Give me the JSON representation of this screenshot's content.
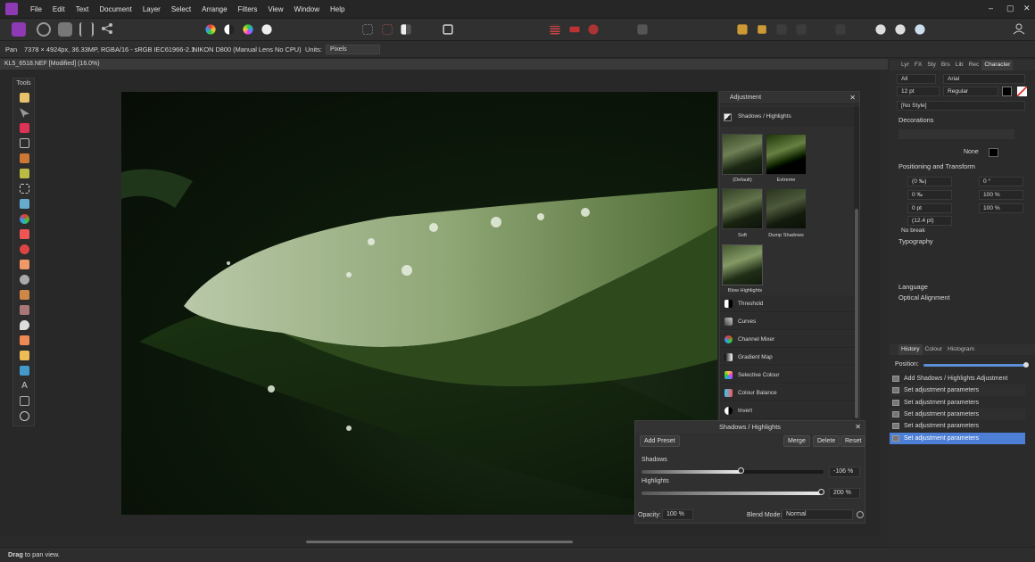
{
  "menubar": {
    "items": [
      "File",
      "Edit",
      "Text",
      "Document",
      "Layer",
      "Select",
      "Arrange",
      "Filters",
      "View",
      "Window",
      "Help"
    ],
    "window_buttons": [
      "–",
      "▢",
      "✕"
    ]
  },
  "context_bar": {
    "tool": "Pan",
    "info": "7378 × 4924px, 36.33MP, RGBA/16 - sRGB IEC61966-2.1",
    "camera": "NIKON D800 (Manual Lens No CPU)",
    "units_label": "Units:",
    "units_value": "Pixels"
  },
  "document": {
    "title": "KL5_6518.NEF [Modified] (16.0%)"
  },
  "tools_panel": {
    "title": "Tools"
  },
  "adjustment_panel": {
    "title": "Adjustment",
    "preset_header": "Shadows / Highlights",
    "presets": [
      "(Default)",
      "Extreme",
      "Soft",
      "Dump Shadows",
      "Blow Highlights"
    ],
    "items": [
      "Threshold",
      "Curves",
      "Channel Mixer",
      "Gradient Map",
      "Selective Colour",
      "Colour Balance",
      "Invert"
    ]
  },
  "shadows_highlights": {
    "title": "Shadows / Highlights",
    "add_preset": "Add Preset",
    "merge": "Merge",
    "delete": "Delete",
    "reset": "Reset",
    "shadows_label": "Shadows",
    "shadows_value": "-106 %",
    "shadows_level": -1.06,
    "highlights_label": "Highlights",
    "highlights_value": "200 %",
    "highlights_level": 2.0,
    "opacity_label": "Opacity:",
    "opacity_value": "100 %",
    "blend_label": "Blend Mode:",
    "blend_value": "Normal"
  },
  "character_panel": {
    "tabs": [
      "Lyr",
      "FX",
      "Sty",
      "Brs",
      "Lib",
      "Rec",
      "Character"
    ],
    "active_tab": "Character",
    "scope": "All",
    "font": "Arial",
    "size": "12 pt",
    "weight": "Regular",
    "style": "[No Style]",
    "decorations_title": "Decorations",
    "decoration_none": "None",
    "positioning_title": "Positioning and Transform",
    "tracking": "(0 ‰)",
    "shear": "0 °",
    "kerning": "0 ‰",
    "hscale": "100 %",
    "baseline": "0 pt",
    "vscale": "100 %",
    "leading": "(12.4 pt)",
    "no_break": "No break",
    "typography_title": "Typography",
    "language_title": "Language",
    "optical_title": "Optical Alignment"
  },
  "history_panel": {
    "tabs": [
      "History",
      "Colour",
      "Histogram"
    ],
    "active_tab": "History",
    "position_label": "Position:",
    "entries": [
      "Add Shadows / Highlights Adjustment",
      "Set adjustment parameters",
      "Set adjustment parameters",
      "Set adjustment parameters",
      "Set adjustment parameters",
      "Set adjustment parameters"
    ],
    "selected_index": 5
  },
  "status_bar": {
    "bold": "Drag",
    "text": " to pan view."
  },
  "colors": {
    "accent": "#4f8fe0",
    "brand": "#8e3ab5",
    "selected": "#4d7fd6"
  }
}
